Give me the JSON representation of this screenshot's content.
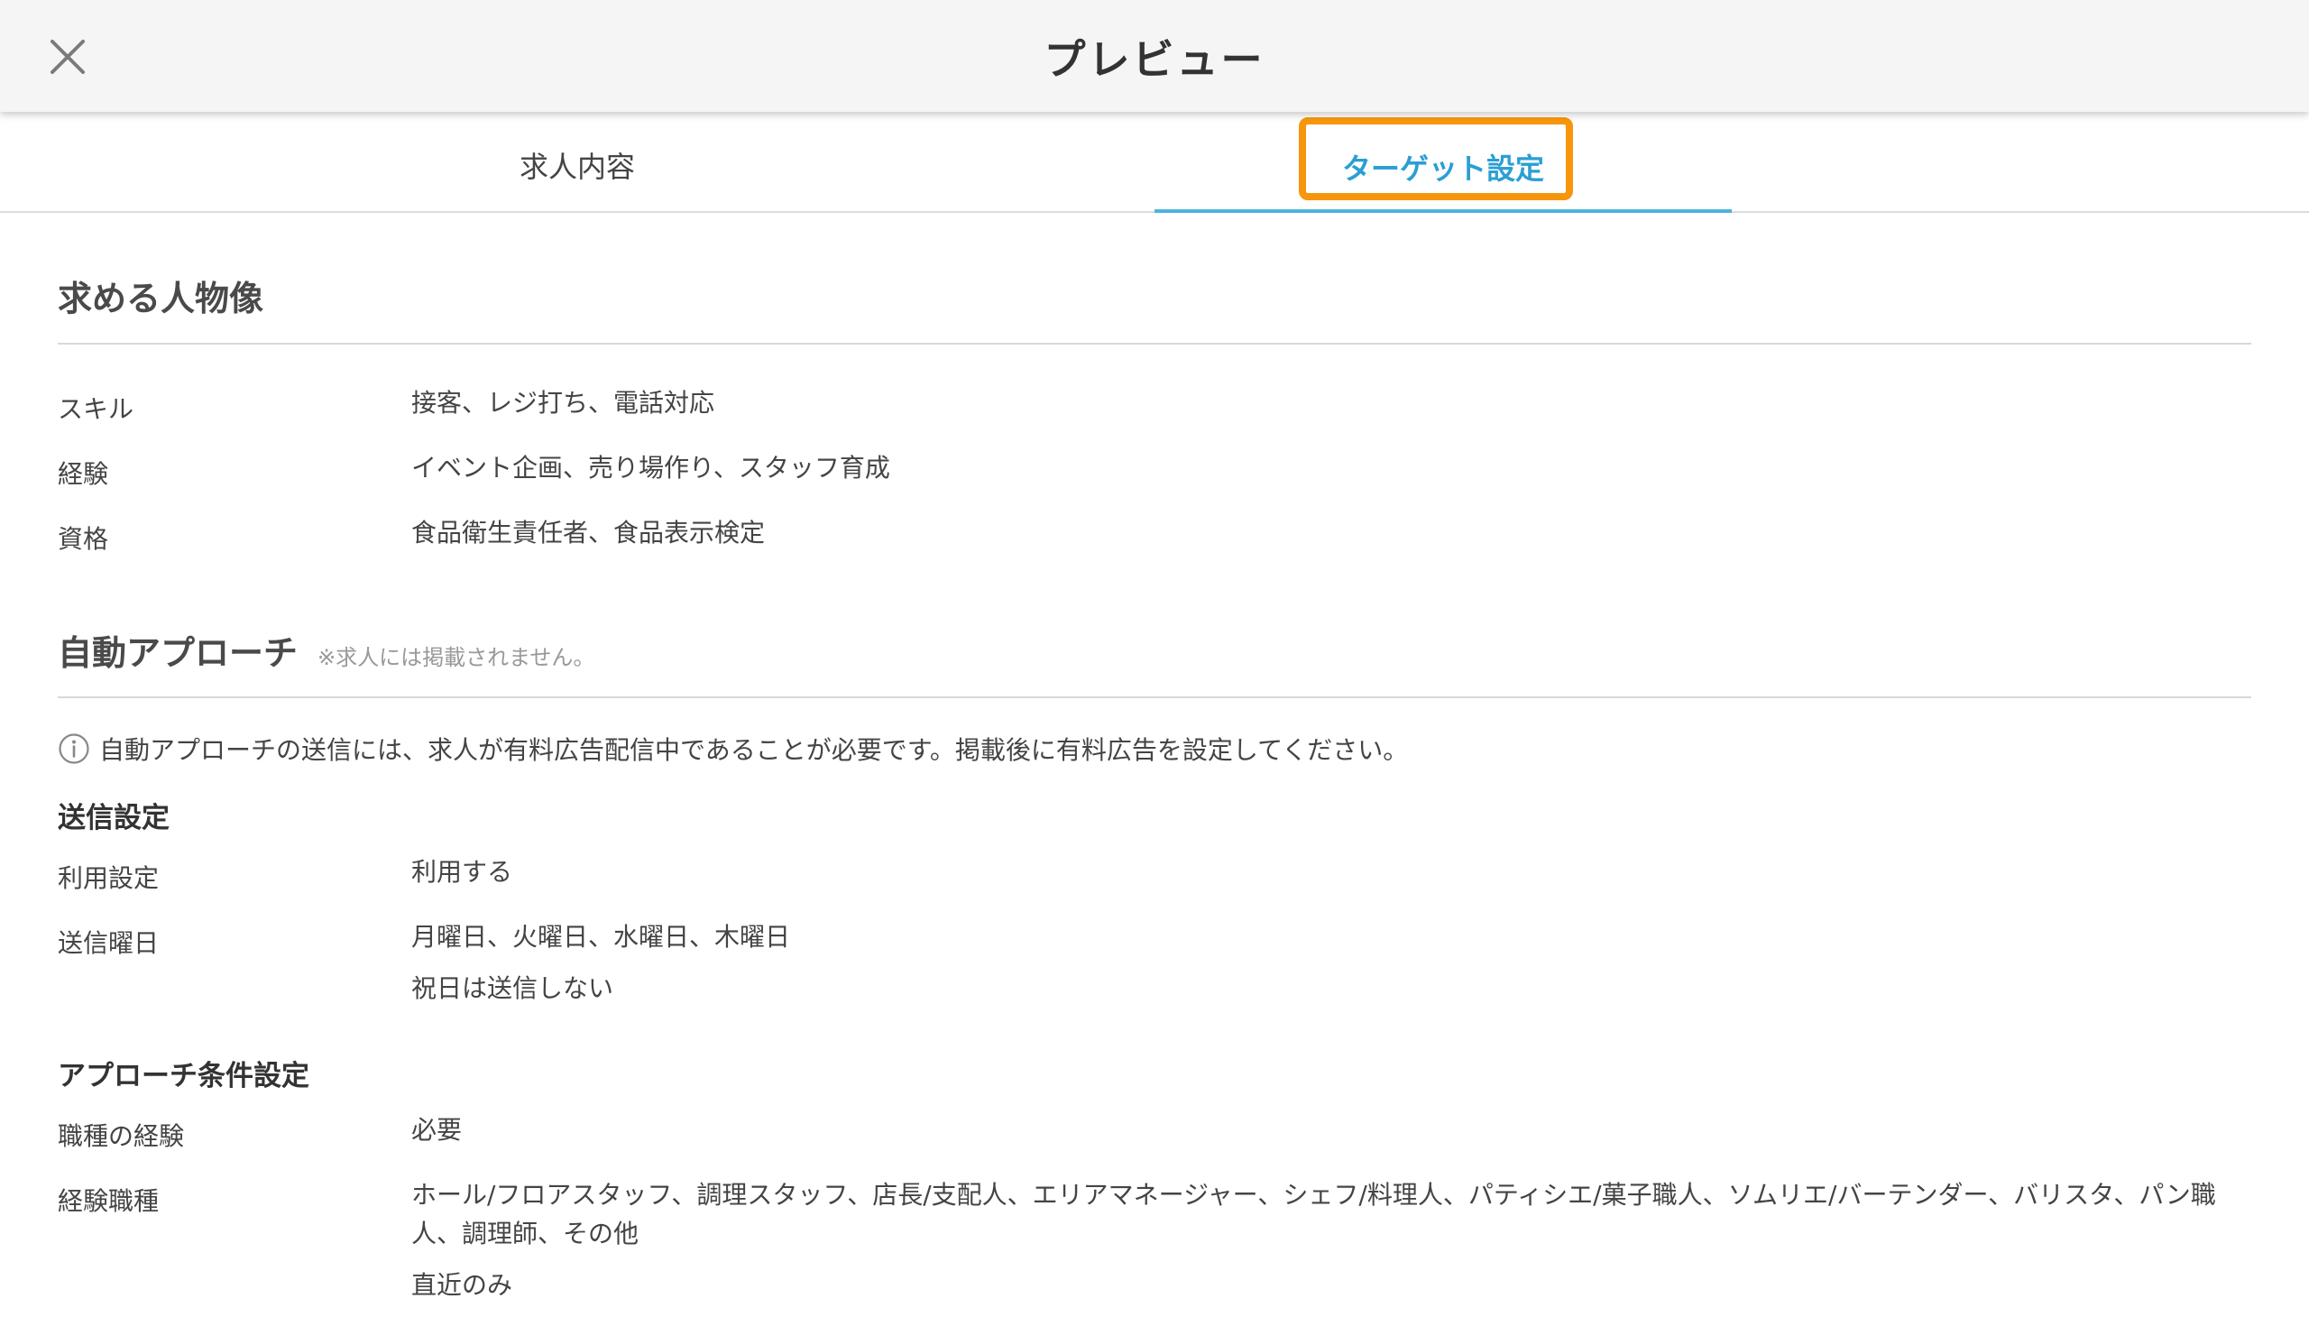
{
  "header": {
    "title": "プレビュー"
  },
  "tabs": [
    {
      "label": "求人内容",
      "active": false
    },
    {
      "label": "ターゲット設定",
      "active": true
    }
  ],
  "persona": {
    "title": "求める人物像",
    "rows": [
      {
        "label": "スキル",
        "value": "接客、レジ打ち、電話対応"
      },
      {
        "label": "経験",
        "value": "イベント企画、売り場作り、スタッフ育成"
      },
      {
        "label": "資格",
        "value": "食品衛生責任者、食品表示検定"
      }
    ]
  },
  "auto_approach": {
    "title": "自動アプローチ",
    "note": "※求人には掲載されません。",
    "info": "自動アプローチの送信には、求人が有料広告配信中であることが必要です。掲載後に有料広告を設定してください。",
    "send_settings": {
      "heading": "送信設定",
      "usage_label": "利用設定",
      "usage_value": "利用する",
      "days_label": "送信曜日",
      "days_value": "月曜日、火曜日、水曜日、木曜日",
      "holiday_value": "祝日は送信しない"
    },
    "conditions": {
      "heading": "アプローチ条件設定",
      "job_exp_label": "職種の経験",
      "job_exp_value": "必要",
      "exp_jobs_label": "経験職種",
      "exp_jobs_line1": "ホール/フロアスタッフ、調理スタッフ、店長/支配人、エリアマネージャー、シェフ/料理人、パティシエ/菓子職人、ソムリエ/バーテンダー、バリスタ、パン職",
      "exp_jobs_line2": "人、調理師、その他",
      "recent_only": "直近のみ"
    }
  },
  "colors": {
    "accent": "#2a9fd4",
    "highlight": "#f7960c",
    "underline": "#4db3dd"
  },
  "icons": {
    "close": "close-icon",
    "info": "info-icon"
  }
}
